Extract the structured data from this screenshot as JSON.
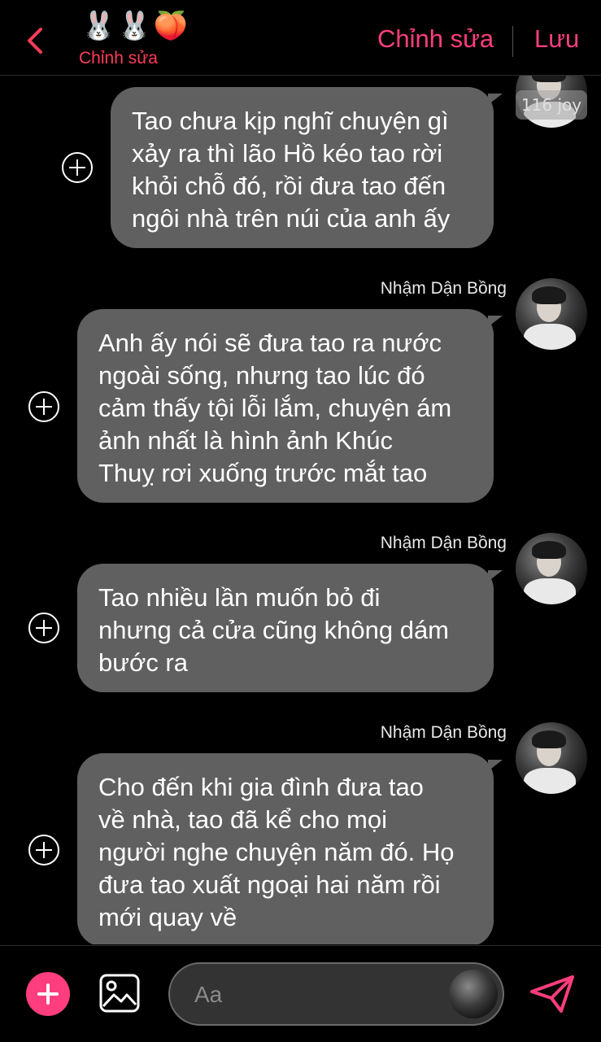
{
  "header": {
    "emojis": "🐰🐰🍑",
    "chat_name": "Chỉnh sửa",
    "edit_label": "Chỉnh sửa",
    "save_label": "Lưu"
  },
  "messages": [
    {
      "text_lines": [
        "Tao chưa kịp nghĩ chuyện gì",
        "xảy ra thì lão Hồ kéo tao rời",
        "khỏi chỗ đó, rồi đưa tao đến",
        "ngôi nhà trên núi của anh ấy"
      ],
      "sender": "",
      "avatar_label": "116 joy"
    },
    {
      "text_lines": [
        "Anh ấy nói sẽ đưa tao ra nước",
        "ngoài sống, nhưng tao lúc đó",
        "cảm thấy tội lỗi lắm, chuyện ám",
        "ảnh nhất là hình ảnh Khúc",
        "Thuỵ rơi xuống trước mắt tao"
      ],
      "sender": "Nhậm Dận Bồng"
    },
    {
      "text_lines": [
        "Tao nhiều lần muốn bỏ đi",
        "nhưng cả cửa cũng không dám",
        "bước ra"
      ],
      "sender": "Nhậm Dận Bồng"
    },
    {
      "text_lines": [
        "Cho đến khi gia đình đưa tao",
        "về nhà, tao đã kể cho mọi",
        "người nghe chuyện năm đó. Họ",
        "đưa tao xuất ngoại hai năm rồi",
        "mới quay về"
      ],
      "sender": "Nhậm Dận Bồng"
    }
  ],
  "composer": {
    "placeholder": "Aa"
  },
  "colors": {
    "accent": "#ff3d7f",
    "bubble": "#606060",
    "background": "#000000"
  },
  "icons": {
    "back": "chevron-left-icon",
    "add": "plus-icon",
    "image": "image-icon",
    "send": "send-icon",
    "message_action": "plus-circle-icon"
  }
}
